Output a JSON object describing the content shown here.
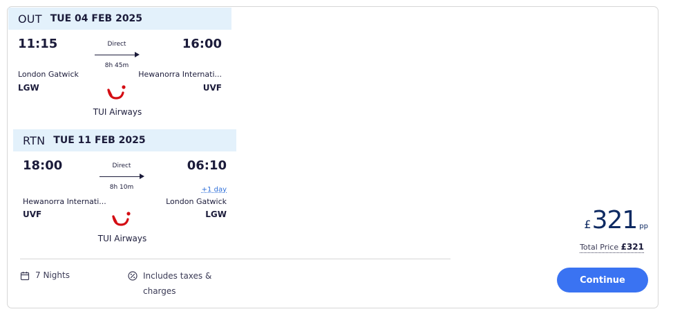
{
  "outbound": {
    "direction": "OUT",
    "date": "TUE 04 FEB 2025",
    "dep_time": "11:15",
    "arr_time": "16:00",
    "stops": "Direct",
    "duration": "8h 45m",
    "dep_city": "London Gatwick",
    "arr_city": "Hewanorra Internati...",
    "dep_code": "LGW",
    "arr_code": "UVF",
    "airline": "TUI Airways"
  },
  "return": {
    "direction": "RTN",
    "date": "TUE 11 FEB 2025",
    "dep_time": "18:00",
    "arr_time": "06:10",
    "plus_day": "+1 day",
    "stops": "Direct",
    "duration": "8h 10m",
    "dep_city": "Hewanorra Internati...",
    "arr_city": "London Gatwick",
    "dep_code": "UVF",
    "arr_code": "LGW",
    "airline": "TUI Airways"
  },
  "footer": {
    "nights": "7 Nights",
    "taxes": "Includes taxes & charges",
    "nights_icon": "calendar-icon",
    "taxes_icon": "percent-icon"
  },
  "price": {
    "currency": "£",
    "amount": "321",
    "unit": "pp",
    "total_label": "Total Price",
    "total_value": "£321"
  },
  "actions": {
    "continue_label": "Continue"
  },
  "colors": {
    "leg_header_bg": "#e3f1fb",
    "price_text": "#0e2a62",
    "button_bg": "#3a73f2",
    "tui_red": "#d40e14"
  }
}
